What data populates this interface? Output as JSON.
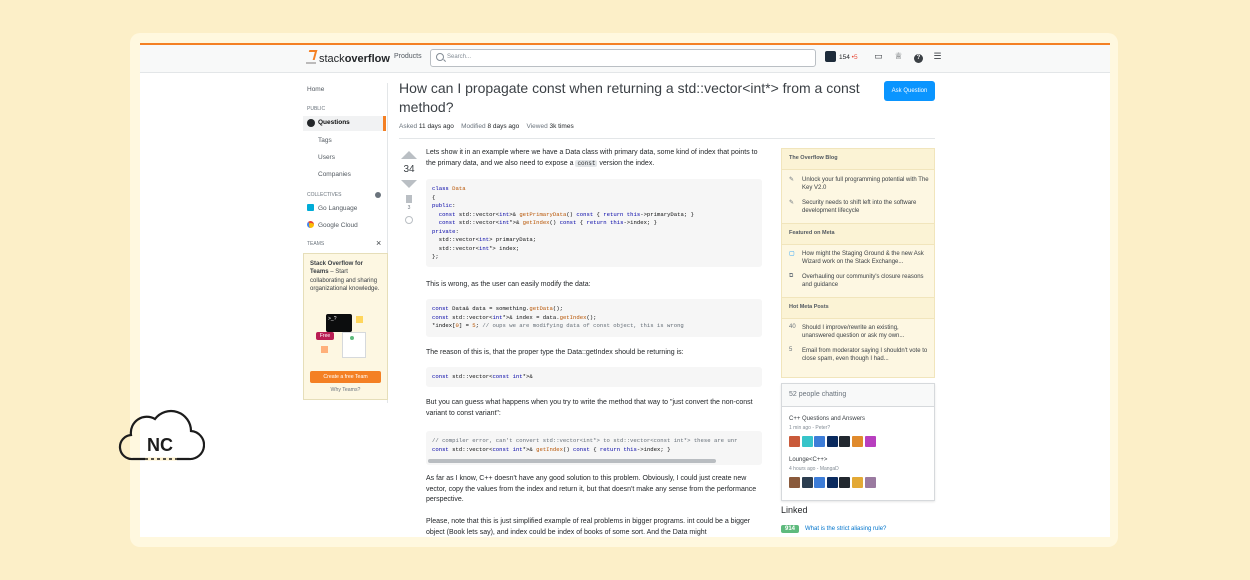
{
  "header": {
    "logo_light": "stack",
    "logo_bold": "overflow",
    "products": "Products",
    "search_placeholder": "Search...",
    "reputation": "154",
    "badge": "•5"
  },
  "left_nav": {
    "home": "Home",
    "public": "PUBLIC",
    "questions": "Questions",
    "tags": "Tags",
    "users": "Users",
    "companies": "Companies",
    "collectives": "COLLECTIVES",
    "go": "Go Language",
    "gcloud": "Google Cloud",
    "teams": "TEAMS",
    "teams_title": "Stack Overflow for Teams",
    "teams_text": "– Start collaborating and sharing organizational knowledge.",
    "free": "Free",
    "create_team": "Create a free Team",
    "why_teams": "Why Teams?"
  },
  "question": {
    "title": "How can I propagate const when returning a std::vector<int*> from a const method?",
    "ask_button": "Ask Question",
    "asked_label": "Asked",
    "asked": "11 days ago",
    "modified_label": "Modified",
    "modified": "8 days ago",
    "viewed_label": "Viewed",
    "viewed": "3k times",
    "score": "34",
    "bookmarks": "3"
  },
  "body": {
    "p1a": "Lets show it in an example where we have a Data class with primary data, some kind of index that points to the primary data, and we also need to expose a",
    "p1_code": "const",
    "p1b": "version the index.",
    "p2": "This is wrong, as the user can easily modify the data:",
    "p3": "The reason of this is, that the proper type the Data::getIndex should be returning is:",
    "p4": "But you can guess what happens when you try to write the method that way to \"just convert the non-const variant to const variant\":",
    "p5": "As far as I know, C++ doesn't have any good solution to this problem. Obviously, I could just create new vector, copy the values from the index and return it, but that doesn't make any sense from the performance perspective.",
    "p6": "Please, note that this is just simplified example of real problems in bigger programs. int could be a bigger object (Book lets say), and index could be index of books of some sort. And the Data might"
  },
  "sidebar": {
    "blog_header": "The Overflow Blog",
    "blog1": "Unlock your full programming potential with The Key V2.0",
    "blog2": "Security needs to shift left into the software development lifecycle",
    "meta_header": "Featured on Meta",
    "meta1": "How might the Staging Ground & the new Ask Wizard work on the Stack Exchange...",
    "meta2": "Overhauling our community's closure reasons and guidance",
    "hot_header": "Hot Meta Posts",
    "hot1_n": "40",
    "hot1": "Should I improve/rewrite an existing, unanswered question or ask my own...",
    "hot2_n": "5",
    "hot2": "Email from moderator saying I shouldn't vote to close spam, even though I had...",
    "chat_header": "52 people chatting",
    "room1": "C++ Questions and Answers",
    "room1_meta": "1 min ago - Peter?",
    "room2": "Lounge<C++>",
    "room2_meta": "4 hours ago - MangaD",
    "linked": "Linked",
    "linked1_n": "914",
    "linked1": "What is the strict aliasing rule?"
  },
  "watermark": "NC"
}
